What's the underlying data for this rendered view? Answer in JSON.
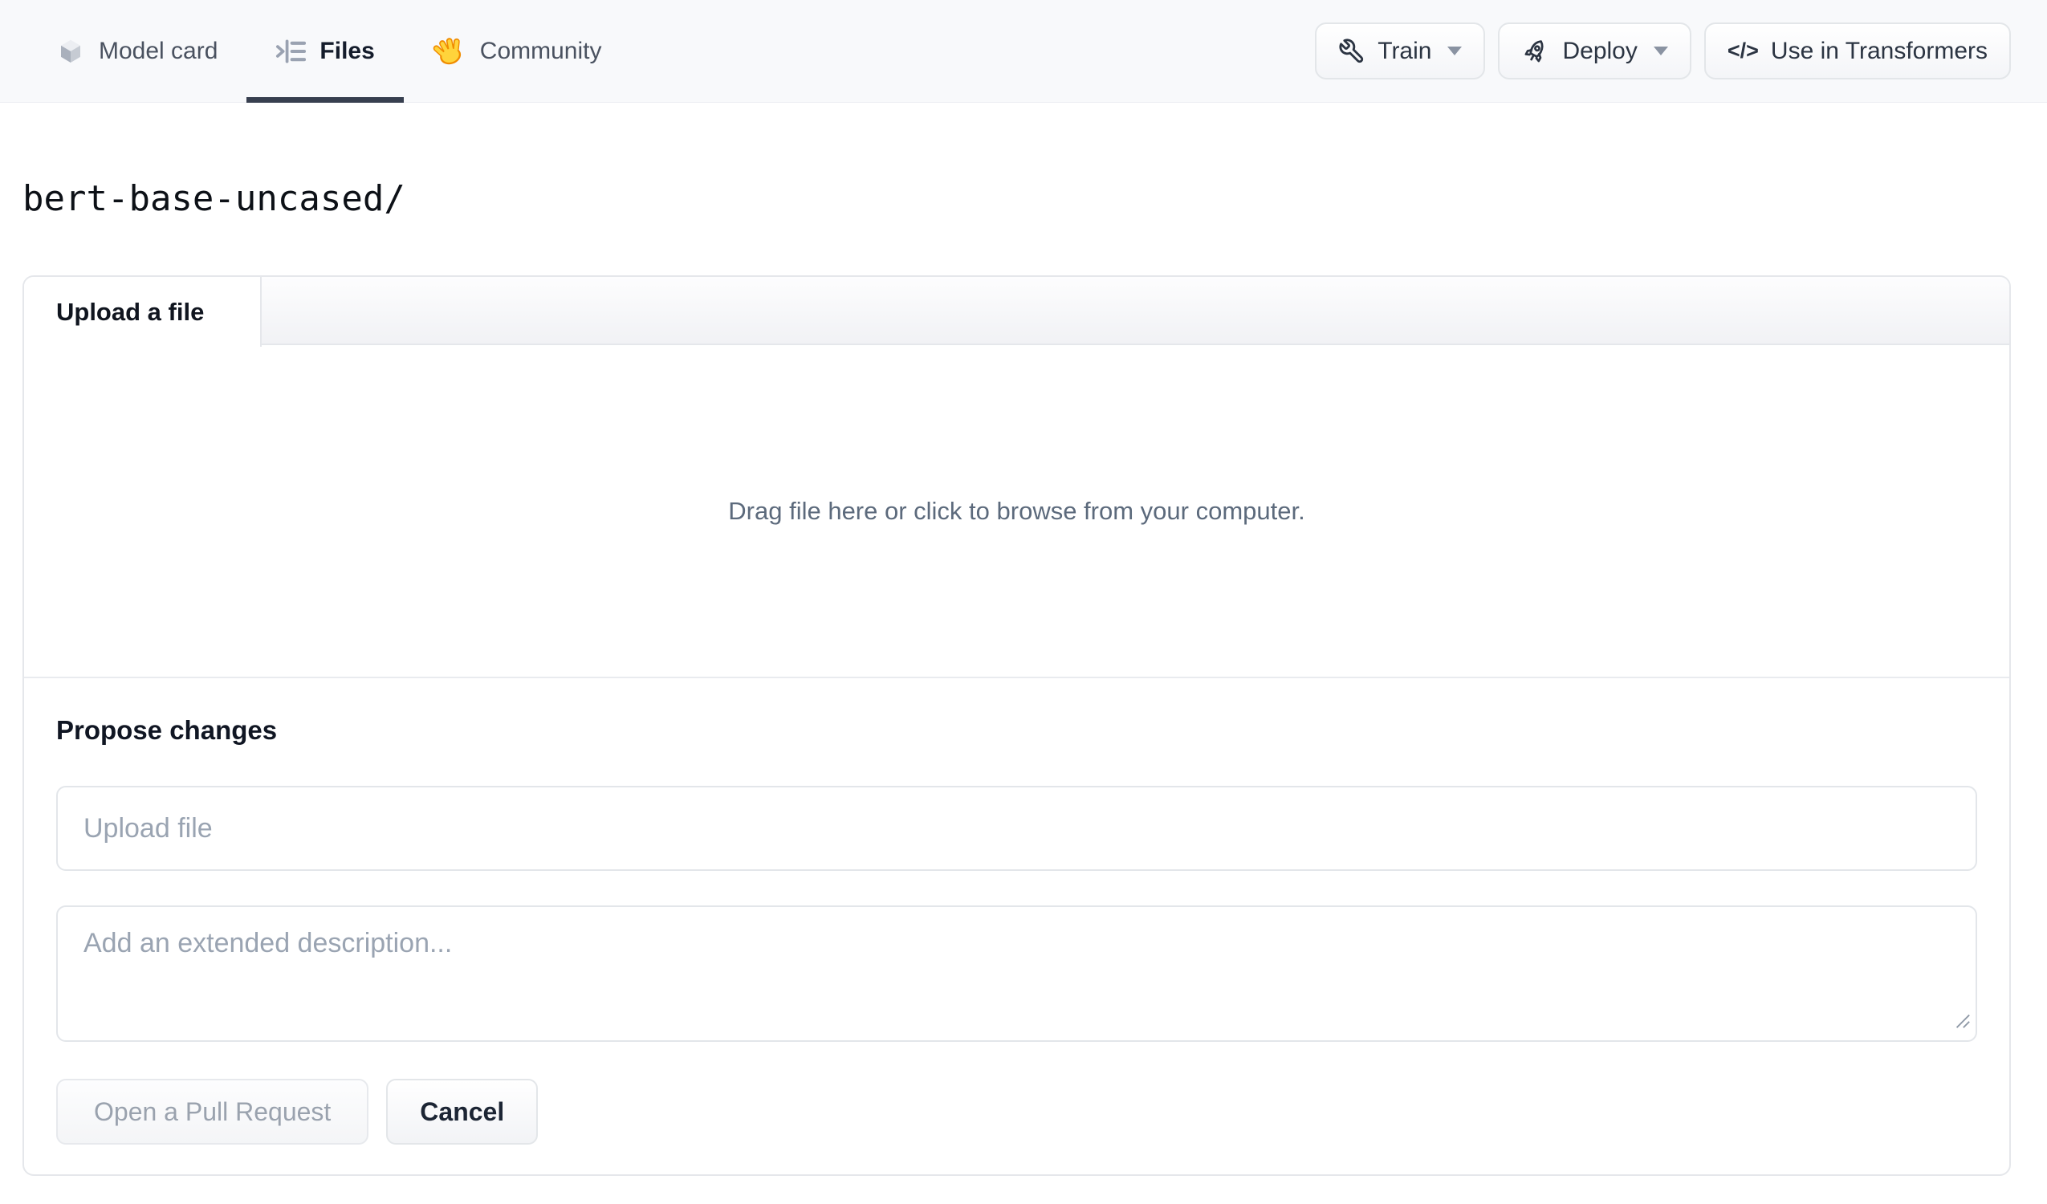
{
  "nav": {
    "tabs": [
      {
        "label": "Model card",
        "active": false
      },
      {
        "label": "Files",
        "active": true
      },
      {
        "label": "Community",
        "active": false
      }
    ],
    "actions": {
      "train": "Train",
      "deploy": "Deploy",
      "use_in_transformers": "Use in Transformers",
      "code_glyph": "</>"
    }
  },
  "path": "bert-base-uncased/",
  "upload_panel": {
    "tab_label": "Upload a file",
    "dropzone_text": "Drag file here or click to browse from your computer.",
    "propose": {
      "heading": "Propose changes",
      "filename_placeholder": "Upload file",
      "filename_value": "",
      "description_placeholder": "Add an extended description...",
      "description_value": "",
      "submit_label": "Open a Pull Request",
      "cancel_label": "Cancel"
    }
  },
  "colors": {
    "active_tab_underline": "#373f4f",
    "header_bg": "#f8f9fb",
    "panel_border": "#e5e7eb",
    "hand_yellow": "#ffd43b",
    "hand_orange": "#f08c00",
    "muted_icon_gray": "#9aa2b1"
  }
}
